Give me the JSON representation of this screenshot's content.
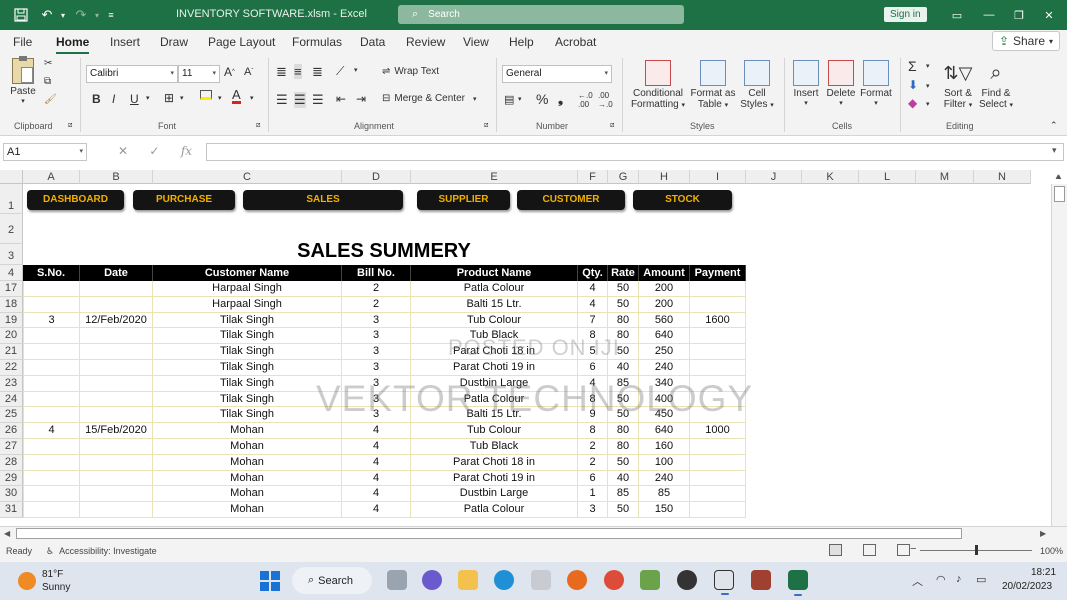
{
  "window": {
    "title": "INVENTORY SOFTWARE.xlsm  -  Excel",
    "search_placeholder": "Search",
    "sign_in": "Sign in"
  },
  "menu": {
    "tabs": [
      "File",
      "Home",
      "Insert",
      "Draw",
      "Page Layout",
      "Formulas",
      "Data",
      "Review",
      "View",
      "Help",
      "Acrobat"
    ],
    "share": "Share"
  },
  "ribbon": {
    "clipboard": {
      "paste": "Paste",
      "label": "Clipboard"
    },
    "font": {
      "name": "Calibri",
      "size": "11",
      "label": "Font"
    },
    "alignment": {
      "wrap": "Wrap Text",
      "merge": "Merge & Center",
      "label": "Alignment"
    },
    "number": {
      "format": "General",
      "label": "Number"
    },
    "styles": {
      "cond1": "Conditional",
      "cond2": "Formatting",
      "fmt1": "Format as",
      "fmt2": "Table",
      "cell1": "Cell",
      "cell2": "Styles",
      "label": "Styles"
    },
    "cells": {
      "insert": "Insert",
      "delete": "Delete",
      "format": "Format",
      "label": "Cells"
    },
    "editing": {
      "sort1": "Sort &",
      "sort2": "Filter",
      "find1": "Find &",
      "find2": "Select",
      "label": "Editing"
    }
  },
  "formula_bar": {
    "name_box": "A1",
    "fx": "fx",
    "formula": ""
  },
  "grid": {
    "columns": [
      "A",
      "B",
      "C",
      "D",
      "E",
      "F",
      "G",
      "H",
      "I",
      "J",
      "K",
      "L",
      "M",
      "N"
    ],
    "row_numbers": [
      "1",
      "2",
      "3",
      "4",
      "17",
      "18",
      "19",
      "20",
      "21",
      "22",
      "23",
      "24",
      "25",
      "26",
      "27",
      "28",
      "29",
      "30",
      "31"
    ],
    "nav_buttons": [
      "DASHBOARD",
      "PURCHASE",
      "SALES",
      "SUPPLIER",
      "CUSTOMER",
      "STOCK"
    ],
    "title": "SALES SUMMERY",
    "headers": [
      "S.No.",
      "Date",
      "Customer Name",
      "Bill No.",
      "Product Name",
      "Qty.",
      "Rate",
      "Amount",
      "Payment"
    ],
    "rows": [
      [
        "",
        "",
        "Harpaal Singh",
        "2",
        "Patla Colour",
        "4",
        "50",
        "200",
        ""
      ],
      [
        "",
        "",
        "Harpaal Singh",
        "2",
        "Balti 15 Ltr.",
        "4",
        "50",
        "200",
        ""
      ],
      [
        "3",
        "12/Feb/2020",
        "Tilak Singh",
        "3",
        "Tub Colour",
        "7",
        "80",
        "560",
        "1600"
      ],
      [
        "",
        "",
        "Tilak Singh",
        "3",
        "Tub Black",
        "8",
        "80",
        "640",
        ""
      ],
      [
        "",
        "",
        "Tilak Singh",
        "3",
        "Parat Choti 18 in",
        "5",
        "50",
        "250",
        ""
      ],
      [
        "",
        "",
        "Tilak Singh",
        "3",
        "Parat Choti 19 in",
        "6",
        "40",
        "240",
        ""
      ],
      [
        "",
        "",
        "Tilak Singh",
        "3",
        "Dustbin Large",
        "4",
        "85",
        "340",
        ""
      ],
      [
        "",
        "",
        "Tilak Singh",
        "3",
        "Patla Colour",
        "8",
        "50",
        "400",
        ""
      ],
      [
        "",
        "",
        "Tilak Singh",
        "3",
        "Balti 15 Ltr.",
        "9",
        "50",
        "450",
        ""
      ],
      [
        "4",
        "15/Feb/2020",
        "Mohan",
        "4",
        "Tub Colour",
        "8",
        "80",
        "640",
        "1000"
      ],
      [
        "",
        "",
        "Mohan",
        "4",
        "Tub Black",
        "2",
        "80",
        "160",
        ""
      ],
      [
        "",
        "",
        "Mohan",
        "4",
        "Parat Choti 18 in",
        "2",
        "50",
        "100",
        ""
      ],
      [
        "",
        "",
        "Mohan",
        "4",
        "Parat Choti 19 in",
        "6",
        "40",
        "240",
        ""
      ],
      [
        "",
        "",
        "Mohan",
        "4",
        "Dustbin Large",
        "1",
        "85",
        "85",
        ""
      ],
      [
        "",
        "",
        "Mohan",
        "4",
        "Patla Colour",
        "3",
        "50",
        "150",
        ""
      ]
    ],
    "watermark_small": "POSTED ON IJI",
    "watermark_large": "VEKTOR TECHNOLOGY"
  },
  "status": {
    "ready": "Ready",
    "accessibility": "Accessibility: Investigate",
    "zoom": "100%"
  },
  "taskbar": {
    "temp": "81°F",
    "condition": "Sunny",
    "search": "Search",
    "time": "18:21",
    "date": "20/02/2023"
  },
  "colors": {
    "excel_green": "#1e7145",
    "nav_button_bg": "#141414",
    "nav_button_text": "#f0b000"
  }
}
